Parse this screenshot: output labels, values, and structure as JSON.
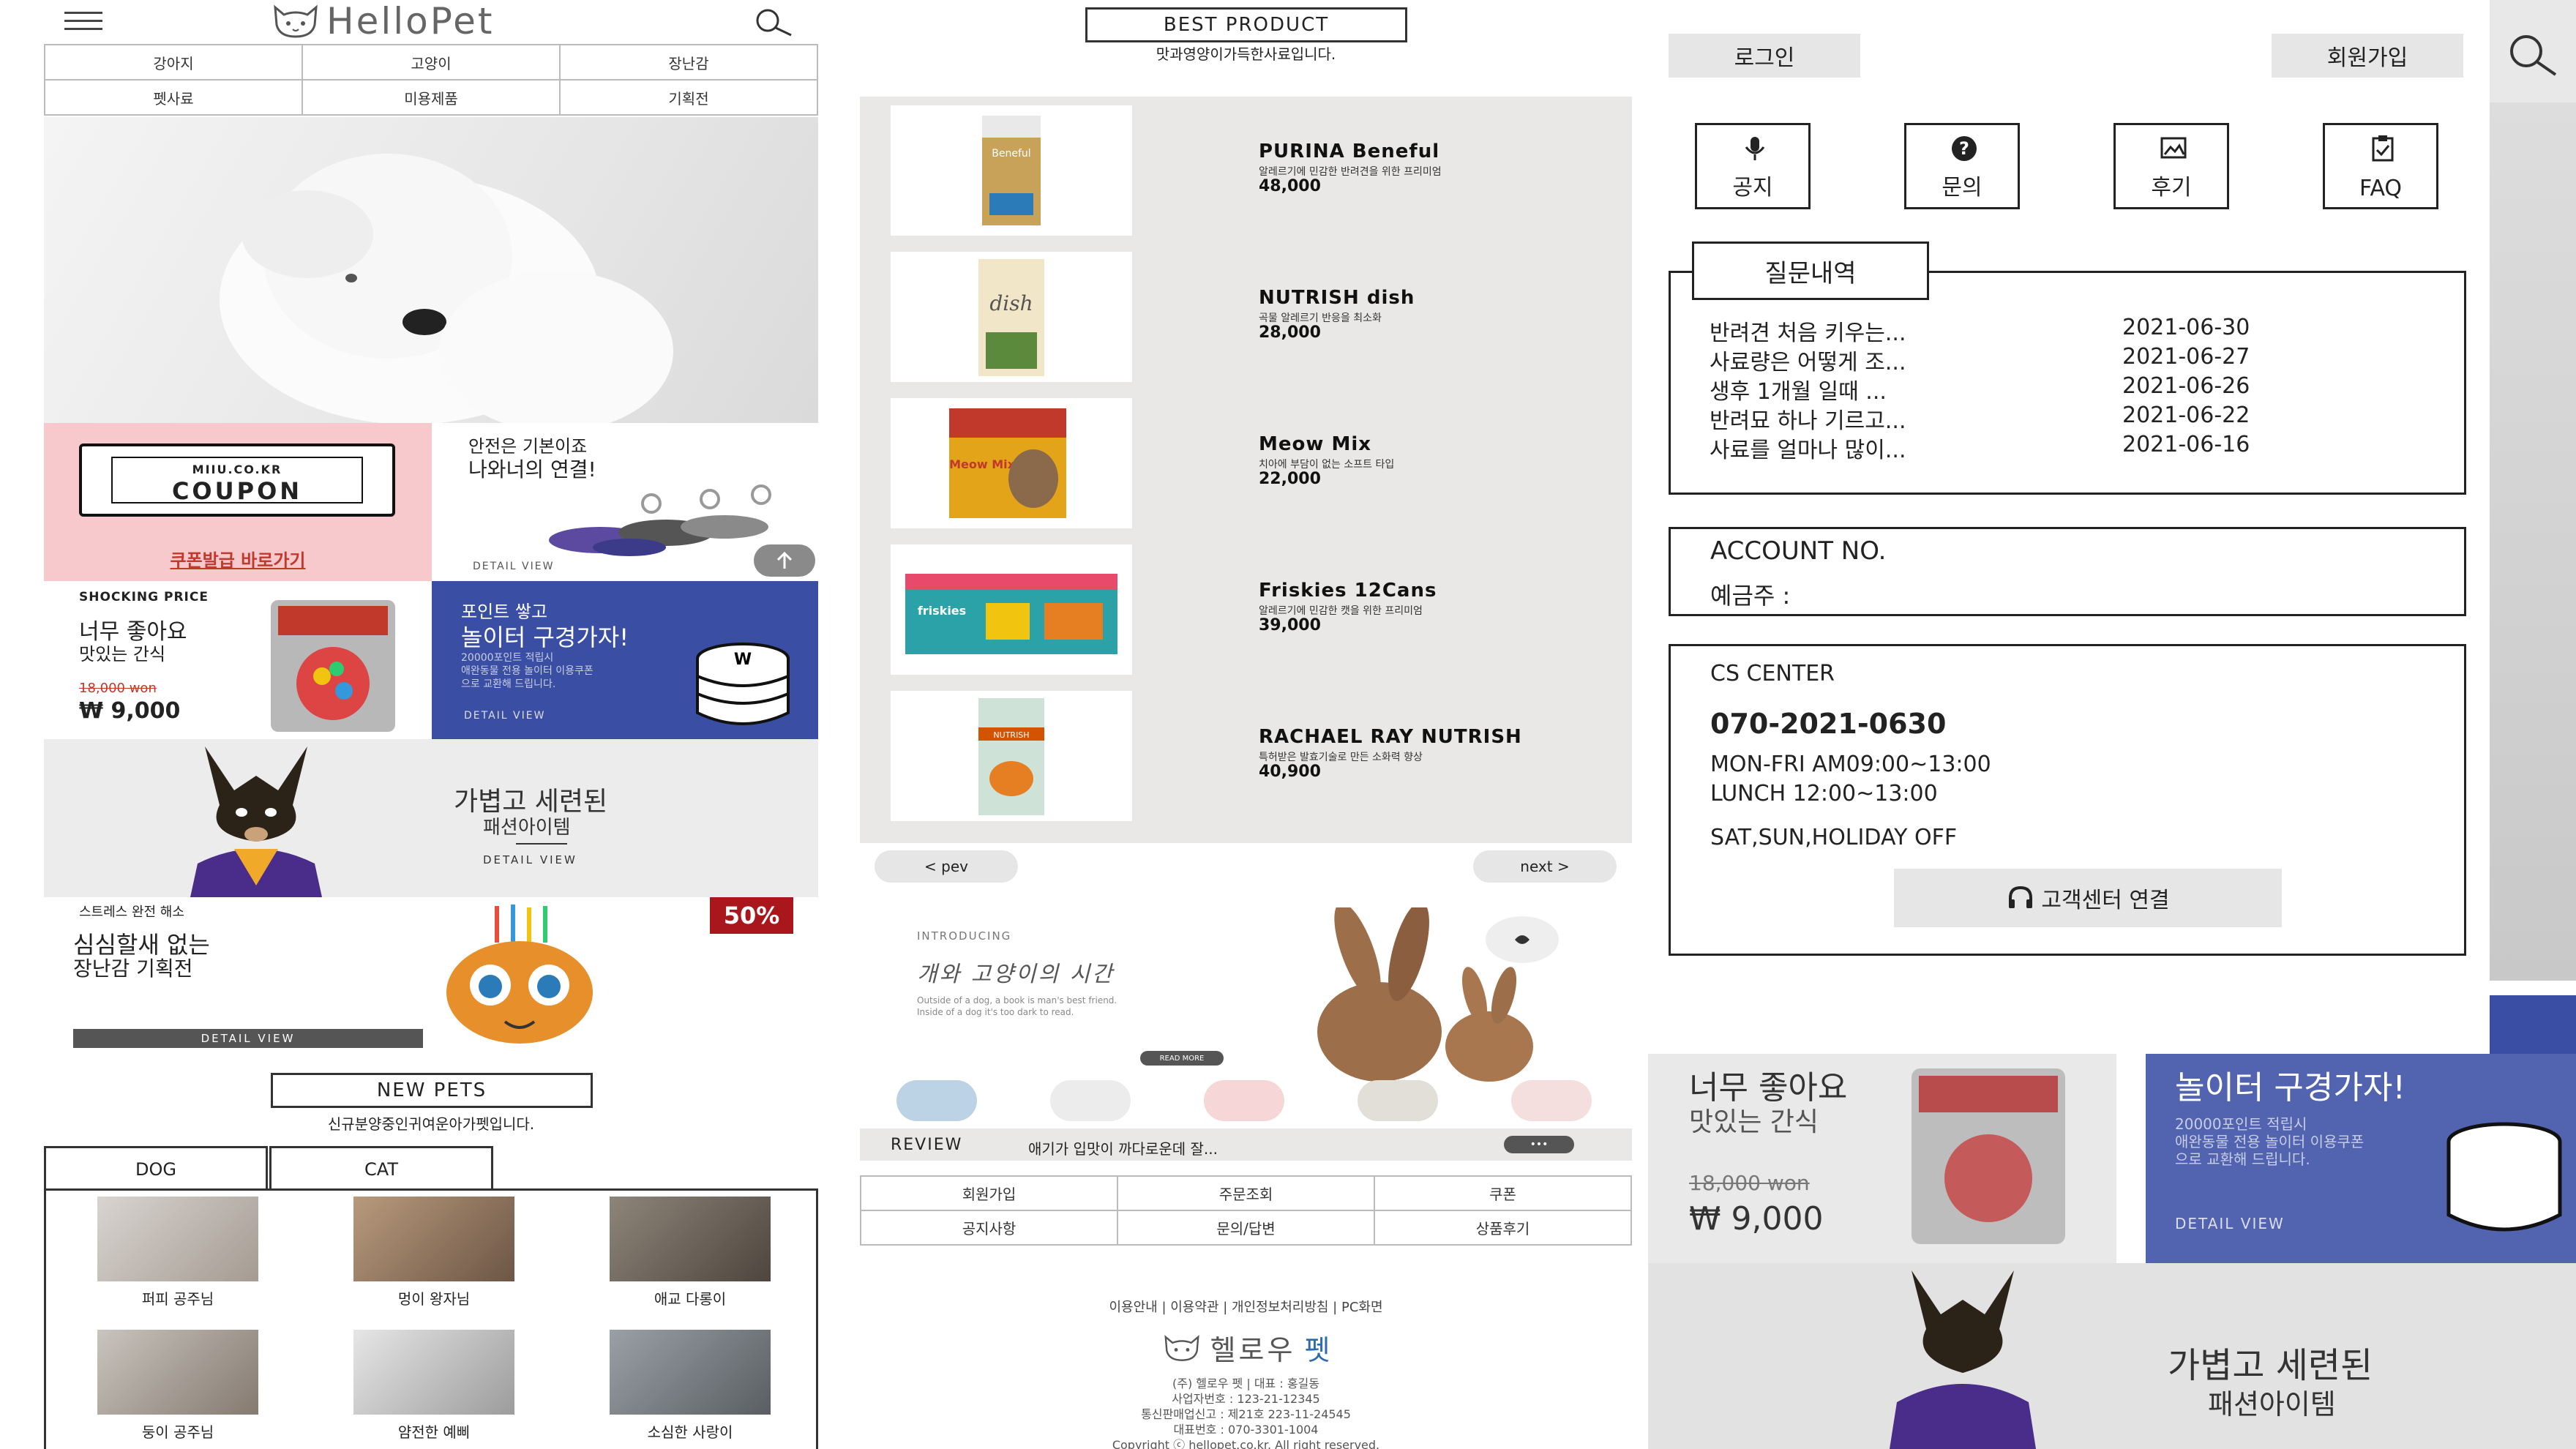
{
  "header": {
    "logo": "HelloPet"
  },
  "categories": [
    "강아지",
    "고양이",
    "장난감",
    "펫사료",
    "미용제품",
    "기획전"
  ],
  "coupon": {
    "site": "MIIU.CO.KR",
    "title": "COUPON",
    "link": "쿠폰발급 바로가기"
  },
  "safety": {
    "line1": "안전은 기본이죠",
    "line2": "나와너의 연결!",
    "detail": "DETAIL VIEW"
  },
  "snack": {
    "tag": "SHOCKING PRICE",
    "line1": "너무 좋아요",
    "line2": "맛있는 간식",
    "old_price": "18,000 won",
    "price": "₩ 9,000"
  },
  "points": {
    "line1": "포인트 쌓고",
    "line2": "놀이터 구경가자!",
    "desc1": "20000포인트 적립시",
    "desc2": "애완동물 전용 놀이터 이용쿠폰",
    "desc3": "으로 교환해 드립니다.",
    "detail": "DETAIL VIEW"
  },
  "fashion": {
    "line1": "가볍고 세련된",
    "line2": "패션아이템",
    "detail": "DETAIL VIEW"
  },
  "toys": {
    "tag": "스트레스 완전 해소",
    "line1": "심심할새 없는",
    "line2": "장난감 기획전",
    "badge": "50%",
    "detail": "DETAIL VIEW"
  },
  "new_pets": {
    "title": "NEW PETS",
    "subtitle": "신규분양중인귀여운아가펫입니다.",
    "tabs": [
      "DOG",
      "CAT"
    ],
    "items": [
      "퍼피 공주님",
      "멍이 왕자님",
      "애교 다롱이",
      "둥이 공주님",
      "얌전한 예삐",
      "소심한 사랑이"
    ]
  },
  "best": {
    "title": "BEST PRODUCT",
    "subtitle": "맛과영양이가득한사료입니다.",
    "products": [
      {
        "name": "PURINA Beneful",
        "desc": "알레르기에 민감한 반려견을 위한 프리미엄",
        "price": "48,000",
        "pkg": "Beneful"
      },
      {
        "name": "NUTRISH dish",
        "desc": "곡물 알레르기 반응을 최소화",
        "price": "28,000",
        "pkg": "dish"
      },
      {
        "name": "Meow Mix",
        "desc": "치아에 부담이 없는 소프트 타입",
        "price": "22,000",
        "pkg": "Meow Mix"
      },
      {
        "name": "Friskies 12Cans",
        "desc": "알레르기에 민감한 캣을 위한 프리미엄",
        "price": "39,000",
        "pkg": "friskies"
      },
      {
        "name": "RACHAEL RAY NUTRISH",
        "desc": "특허받은 발효기술로 만든 소화력 향상",
        "price": "40,900",
        "pkg": "NUTRISH"
      }
    ]
  },
  "pager": {
    "prev": "< pev",
    "next": "next >"
  },
  "intro": {
    "tag": "INTRODUCING",
    "title": "개와 고양이의 시간",
    "desc1": "Outside of a dog, a book is man's best friend.",
    "desc2": "Inside of a dog it's too dark to read.",
    "more": "READ MORE"
  },
  "review": {
    "label": "REVIEW",
    "text": "애기가 입맛이 까다로운데 잘...",
    "more": "•••"
  },
  "footer_links": [
    "회원가입",
    "주문조회",
    "쿠폰",
    "공지사항",
    "문의/답변",
    "상품후기"
  ],
  "footer": {
    "bottom_links": "이용안내 | 이용약관 | 개인정보처리방침 | PC화면",
    "brand1": "헬로우",
    "brand2": "펫",
    "company": "(주) 헬로우 펫 | 대표 : 홍길동",
    "biz_no": "사업자번호 : 123-21-12345",
    "mail_order": "통신판매업신고 : 제21호 223-11-24545",
    "phone": "대표번호 : 070-3301-1004",
    "copyright": "Copyright ⓒ hellopet.co.kr. All right reserved."
  },
  "side_menu": {
    "login": "로그인",
    "join": "회원가입",
    "icons": [
      {
        "label": "공지",
        "icon": "microphone-icon"
      },
      {
        "label": "문의",
        "icon": "question-icon"
      },
      {
        "label": "후기",
        "icon": "image-icon"
      },
      {
        "label": "FAQ",
        "icon": "clipboard-icon"
      }
    ],
    "qna_title": "질문내역",
    "qna": [
      {
        "q": "반려견 처음 키우는...",
        "d": "2021-06-30"
      },
      {
        "q": "사료량은 어떻게 조...",
        "d": "2021-06-27"
      },
      {
        "q": "생후 1개월 일때 ...",
        "d": "2021-06-26"
      },
      {
        "q": "반려묘 하나 기르고...",
        "d": "2021-06-22"
      },
      {
        "q": "사료를 얼마나 많이...",
        "d": "2021-06-16"
      }
    ],
    "account_no": "ACCOUNT NO.",
    "depositor": "예금주 :",
    "cs_title": "CS CENTER",
    "cs_phone": "070-2021-0630",
    "cs_hours1": "MON-FRI AM09:00~13:00",
    "cs_hours2": "LUNCH 12:00~13:00",
    "cs_off": "SAT,SUN,HOLIDAY OFF",
    "cs_button": "고객센터 연결"
  },
  "colors": {
    "pink": "#f7c9cd",
    "blue": "#3a4fa3",
    "gray": "#e9e8e6",
    "dark": "#555555"
  }
}
